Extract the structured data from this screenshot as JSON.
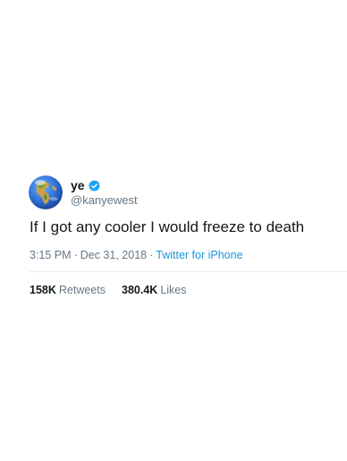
{
  "tweet": {
    "display_name": "ye",
    "handle": "@kanyewest",
    "avatar_icon": "earth-globe-icon",
    "verified_icon": "verified-badge-icon",
    "text": "If I got any cooler I would freeze to death",
    "time": "3:15 PM",
    "separator": "·",
    "date": "Dec 31, 2018",
    "source": "Twitter for iPhone",
    "retweets_count": "158K",
    "retweets_label": "Retweets",
    "likes_count": "380.4K",
    "likes_label": "Likes"
  },
  "colors": {
    "text_primary": "#14171a",
    "text_secondary": "#657786",
    "link": "#1b95e0",
    "verified": "#1da1f2",
    "divider": "#e6ecf0"
  }
}
